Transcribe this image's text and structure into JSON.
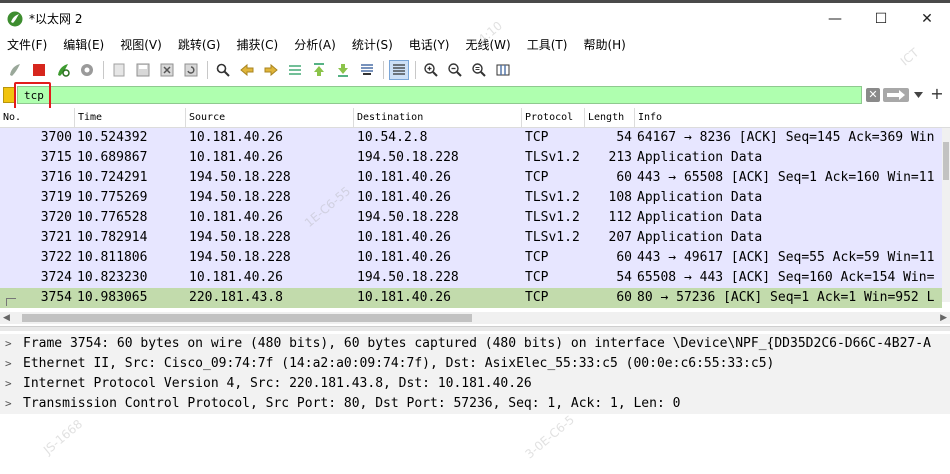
{
  "window": {
    "title": "*以太网 2",
    "minimize": "—",
    "maximize": "☐",
    "close": "✕"
  },
  "menu": [
    "文件(F)",
    "编辑(E)",
    "视图(V)",
    "跳转(G)",
    "捕获(C)",
    "分析(A)",
    "统计(S)",
    "电话(Y)",
    "无线(W)",
    "工具(T)",
    "帮助(H)"
  ],
  "filter": {
    "value": "tcp",
    "clear_label": "✕",
    "add_label": "+"
  },
  "packet_list": {
    "columns": [
      "No.",
      "Time",
      "Source",
      "Destination",
      "Protocol",
      "Length",
      "Info"
    ],
    "rows": [
      {
        "no": "3700",
        "time": "10.524392",
        "src": "10.181.40.26",
        "dst": "10.54.2.8",
        "proto": "TCP",
        "len": "54",
        "info": "64167 → 8236 [ACK] Seq=145 Ack=369 Win",
        "kind": "tcp"
      },
      {
        "no": "3715",
        "time": "10.689867",
        "src": "10.181.40.26",
        "dst": "194.50.18.228",
        "proto": "TLSv1.2",
        "len": "213",
        "info": "Application Data",
        "kind": "tls"
      },
      {
        "no": "3716",
        "time": "10.724291",
        "src": "194.50.18.228",
        "dst": "10.181.40.26",
        "proto": "TCP",
        "len": "60",
        "info": "443 → 65508 [ACK] Seq=1 Ack=160 Win=11",
        "kind": "tcp"
      },
      {
        "no": "3719",
        "time": "10.775269",
        "src": "194.50.18.228",
        "dst": "10.181.40.26",
        "proto": "TLSv1.2",
        "len": "108",
        "info": "Application Data",
        "kind": "tls"
      },
      {
        "no": "3720",
        "time": "10.776528",
        "src": "10.181.40.26",
        "dst": "194.50.18.228",
        "proto": "TLSv1.2",
        "len": "112",
        "info": "Application Data",
        "kind": "tls"
      },
      {
        "no": "3721",
        "time": "10.782914",
        "src": "194.50.18.228",
        "dst": "10.181.40.26",
        "proto": "TLSv1.2",
        "len": "207",
        "info": "Application Data",
        "kind": "tls"
      },
      {
        "no": "3722",
        "time": "10.811806",
        "src": "194.50.18.228",
        "dst": "10.181.40.26",
        "proto": "TCP",
        "len": "60",
        "info": "443 → 49617 [ACK] Seq=55 Ack=59 Win=11",
        "kind": "tcp"
      },
      {
        "no": "3724",
        "time": "10.823230",
        "src": "10.181.40.26",
        "dst": "194.50.18.228",
        "proto": "TCP",
        "len": "54",
        "info": "65508 → 443 [ACK] Seq=160 Ack=154 Win=",
        "kind": "tcp"
      },
      {
        "no": "3754",
        "time": "10.983065",
        "src": "220.181.43.8",
        "dst": "10.181.40.26",
        "proto": "TCP",
        "len": "60",
        "info": "80 → 57236 [ACK] Seq=1 Ack=1 Win=952 L",
        "kind": "selected"
      }
    ]
  },
  "details": [
    "Frame 3754: 60 bytes on wire (480 bits), 60 bytes captured (480 bits) on interface \\Device\\NPF_{DD35D2C6-D66C-4B27-A",
    "Ethernet II, Src: Cisco_09:74:7f (14:a2:a0:09:74:7f), Dst: AsixElec_55:33:c5 (00:0e:c6:55:33:c5)",
    "Internet Protocol Version 4, Src: 220.181.43.8, Dst: 10.181.40.26",
    "Transmission Control Protocol, Src Port: 80, Dst Port: 57236, Seq: 1, Ack: 1, Len: 0"
  ],
  "watermark": [
    "14:10",
    "1E-C6-55",
    "JS-1668",
    "3-0E-C6-5",
    "ICT"
  ],
  "colors": {
    "filter_valid": "#afffaf",
    "row_tcp": "#e7e6ff",
    "row_selected": "#c2dbac",
    "highlight_box": "#e21b1b"
  }
}
